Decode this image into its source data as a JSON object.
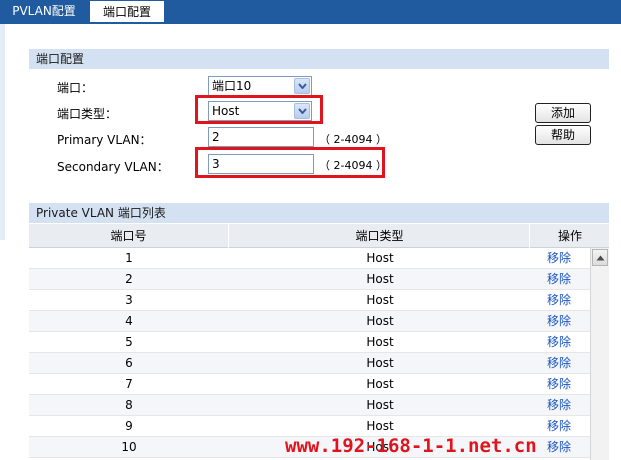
{
  "tabs": [
    {
      "label": "PVLAN配置",
      "active": false
    },
    {
      "label": "端口配置",
      "active": true
    }
  ],
  "config": {
    "section_title": "端口配置",
    "port": {
      "label": "端口：",
      "value": "端口10"
    },
    "port_type": {
      "label": "端口类型：",
      "value": "Host"
    },
    "primary_vlan": {
      "label": "Primary VLAN：",
      "value": "2",
      "range": "（ 2-4094 ）"
    },
    "secondary_vlan": {
      "label": "Secondary VLAN：",
      "value": "3",
      "range": "（ 2-4094 ）"
    },
    "add_button": "添加",
    "help_button": "帮助"
  },
  "list": {
    "section_title": "Private VLAN 端口列表",
    "columns": [
      "端口号",
      "端口类型",
      "操作"
    ],
    "rows": [
      {
        "port": "1",
        "type": "Host",
        "action": "移除"
      },
      {
        "port": "2",
        "type": "Host",
        "action": "移除"
      },
      {
        "port": "3",
        "type": "Host",
        "action": "移除"
      },
      {
        "port": "4",
        "type": "Host",
        "action": "移除"
      },
      {
        "port": "5",
        "type": "Host",
        "action": "移除"
      },
      {
        "port": "6",
        "type": "Host",
        "action": "移除"
      },
      {
        "port": "7",
        "type": "Host",
        "action": "移除"
      },
      {
        "port": "8",
        "type": "Host",
        "action": "移除"
      },
      {
        "port": "9",
        "type": "Host",
        "action": "移除"
      },
      {
        "port": "10",
        "type": "Host",
        "action": "移除"
      }
    ]
  },
  "watermark": "www.192-168-1-1.net.cn",
  "colors": {
    "tab_bar": "#1f5b9e",
    "section_header": "#d3e1f2",
    "highlight": "#e0141c",
    "link": "#1a55c2"
  },
  "icons": {
    "dropdown": "chevron-down-icon",
    "scroll_up": "triangle-up-icon"
  }
}
